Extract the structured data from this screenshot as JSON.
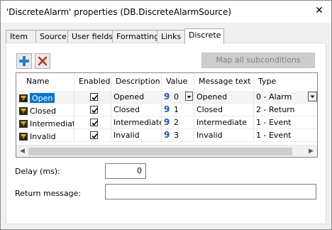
{
  "window": {
    "title": "'DiscreteAlarm' properties (DB.DiscreteAlarmSource)",
    "close_glyph": "✕"
  },
  "tabs": [
    {
      "label": "Item"
    },
    {
      "label": "Source"
    },
    {
      "label": "User fields"
    },
    {
      "label": "Formatting"
    },
    {
      "label": "Links"
    },
    {
      "label": "Discrete",
      "active": true
    }
  ],
  "toolbar": {
    "add_icon": "plus-icon",
    "delete_icon": "delete-x-icon",
    "map_button_label": "Map all subconditions"
  },
  "grid": {
    "columns": [
      "Name",
      "Enabled",
      "Description",
      "Value",
      "Message text",
      "Type"
    ],
    "rows": [
      {
        "name": "Open",
        "enabled": true,
        "description": "Opened",
        "value": "0",
        "message": "Opened",
        "type": "0 - Alarm",
        "selected": true
      },
      {
        "name": "Closed",
        "enabled": true,
        "description": "Closed",
        "value": "1",
        "message": "Closed",
        "type": "2 - Return"
      },
      {
        "name": "Intermediate",
        "enabled": true,
        "description": "Intermediate",
        "value": "2",
        "message": "Intermediate",
        "type": "1 - Event"
      },
      {
        "name": "Invalid",
        "enabled": true,
        "description": "Invalid",
        "value": "3",
        "message": "Invalid",
        "type": "1 - Event"
      }
    ]
  },
  "fields": {
    "delay_label": "Delay (ms):",
    "delay_value": "0",
    "return_label": "Return message:",
    "return_value": ""
  },
  "colors": {
    "selection": "#0078d7",
    "icon_blue": "#1e50d8",
    "delete_red": "#c42b1c"
  }
}
